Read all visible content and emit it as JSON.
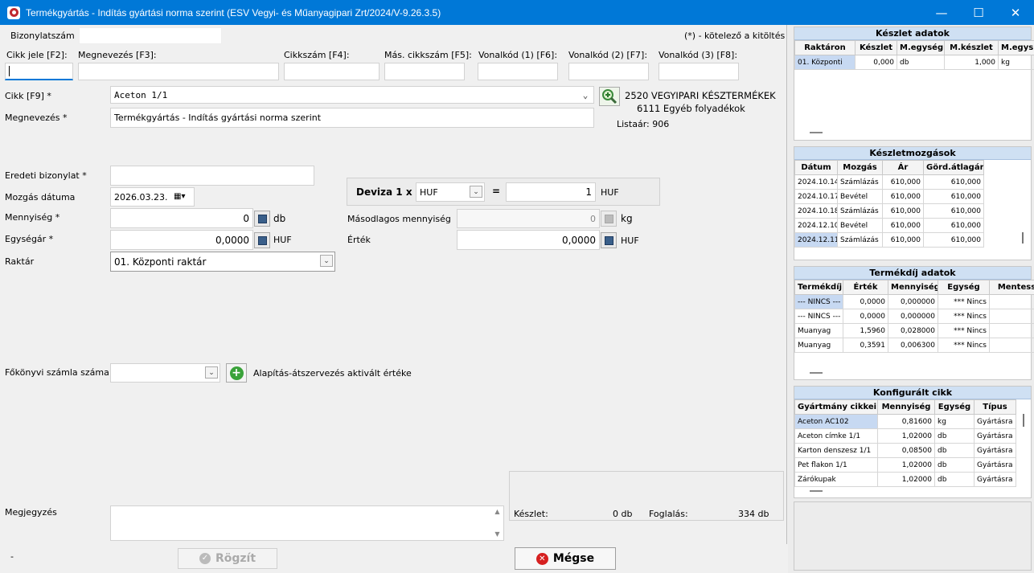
{
  "window": {
    "title": "Termékgyártás - Indítás gyártási norma szerint (ESV Vegyi- és Műanyagipari Zrt/2024/V-9.26.3.5)",
    "minimize": "—",
    "maximize": "☐",
    "close": "✕"
  },
  "header": {
    "doc_label": "Bizonylatszám",
    "doc_value": "",
    "required_note": "(*) - kötelező a kitöltés"
  },
  "search": {
    "cikk_jele": "Cikk jele [F2]:",
    "megnevezes": "Megnevezés [F3]:",
    "cikkszam": "Cikkszám [F4]:",
    "mas_cikkszam": "Más. cikkszám [F5]:",
    "vonalkod1": "Vonalkód (1) [F6]:",
    "vonalkod2": "Vonalkód (2) [F7]:",
    "vonalkod3": "Vonalkód (3) [F8]:"
  },
  "form": {
    "cikk_label": "Cikk [F9] *",
    "cikk_value": "Aceton 1/1",
    "megnev_label": "Megnevezés *",
    "megnev_value": "Termékgyártás - Indítás gyártási norma szerint",
    "group1": "2520 VEGYIPARI KÉSZTERMÉKEK",
    "group2": "6111 Egyéb folyadékok",
    "listaar": "Listaár: 906",
    "eredeti_label": "Eredeti bizonylat *",
    "eredeti_value": "",
    "datum_label": "Mozgás dátuma",
    "datum_value": "2026.03.23.",
    "menny_label": "Mennyiség *",
    "menny_value": "0",
    "menny_unit": "db",
    "egysegar_label": "Egységár *",
    "egysegar_value": "0,0000",
    "egysegar_unit": "HUF",
    "raktar_label": "Raktár",
    "raktar_value": "01. Központi raktár",
    "deviza_label": "Deviza 1 x",
    "deviza_value": "HUF",
    "deviza_eq": "=",
    "deviza_rate": "1",
    "deviza_unit": "HUF",
    "masod_label": "Másodlagos mennyiség",
    "masod_value": "0",
    "masod_unit": "kg",
    "ertek_label": "Érték",
    "ertek_value": "0,0000",
    "ertek_unit": "HUF",
    "fokonyvi_label": "Főkönyvi számla száma",
    "fokonyvi_value": "",
    "alapitas_label": "Alapítás-átszervezés aktivált értéke",
    "megjegyzes_label": "Megjegyzés",
    "megjegyzes_value": "",
    "keszlet_label": "Készlet:",
    "keszlet_value": "0 db",
    "foglalas_label": "Foglalás:",
    "foglalas_value": "334 db"
  },
  "footer": {
    "status": "-",
    "save": "Rögzít",
    "cancel": "Mégse"
  },
  "stock": {
    "title": "Készlet adatok",
    "headers": [
      "Raktáron",
      "Készlet",
      "M.egység",
      "M.készlet",
      "M.egys"
    ],
    "rows": [
      [
        "01. Központi",
        "0,000",
        "db",
        "1,000",
        "kg"
      ]
    ]
  },
  "moves": {
    "title": "Készletmozgások",
    "headers": [
      "Dátum",
      "Mozgás",
      "Ár",
      "Görd.átlagár"
    ],
    "rows": [
      [
        "2024.10.14",
        "Számlázás",
        "610,000",
        "610,000"
      ],
      [
        "2024.10.17",
        "Bevétel",
        "610,000",
        "610,000"
      ],
      [
        "2024.10.18",
        "Számlázás",
        "610,000",
        "610,000"
      ],
      [
        "2024.12.10",
        "Bevétel",
        "610,000",
        "610,000"
      ],
      [
        "2024.12.11",
        "Számlázás",
        "610,000",
        "610,000"
      ]
    ]
  },
  "fee": {
    "title": "Termékdíj adatok",
    "headers": [
      "Termékdíj",
      "Érték",
      "Mennyiség",
      "Egység",
      "Mentess"
    ],
    "rows": [
      [
        "--- NINCS ---",
        "0,0000",
        "0,000000",
        "*** Nincs",
        ""
      ],
      [
        "--- NINCS ---",
        "0,0000",
        "0,000000",
        "*** Nincs",
        ""
      ],
      [
        "Muanyag",
        "1,5960",
        "0,028000",
        "*** Nincs",
        ""
      ],
      [
        "Muanyag",
        "0,3591",
        "0,006300",
        "*** Nincs",
        ""
      ]
    ]
  },
  "config": {
    "title": "Konfigurált cikk",
    "headers": [
      "Gyártmány cikkei",
      "Mennyiség",
      "Egység",
      "Típus"
    ],
    "rows": [
      [
        "Aceton AC102",
        "0,81600",
        "kg",
        "Gyártásra"
      ],
      [
        "Aceton címke 1/1",
        "1,02000",
        "db",
        "Gyártásra"
      ],
      [
        "Karton denszesz 1/1",
        "0,08500",
        "db",
        "Gyártásra"
      ],
      [
        "Pet flakon 1/1",
        "1,02000",
        "db",
        "Gyártásra"
      ],
      [
        "Zárókupak",
        "1,02000",
        "db",
        "Gyártásra"
      ]
    ]
  },
  "colors": {
    "titlebar": "#0078d7",
    "panel_header": "#cfe0f3",
    "selected_row": "#c7d9f2"
  }
}
